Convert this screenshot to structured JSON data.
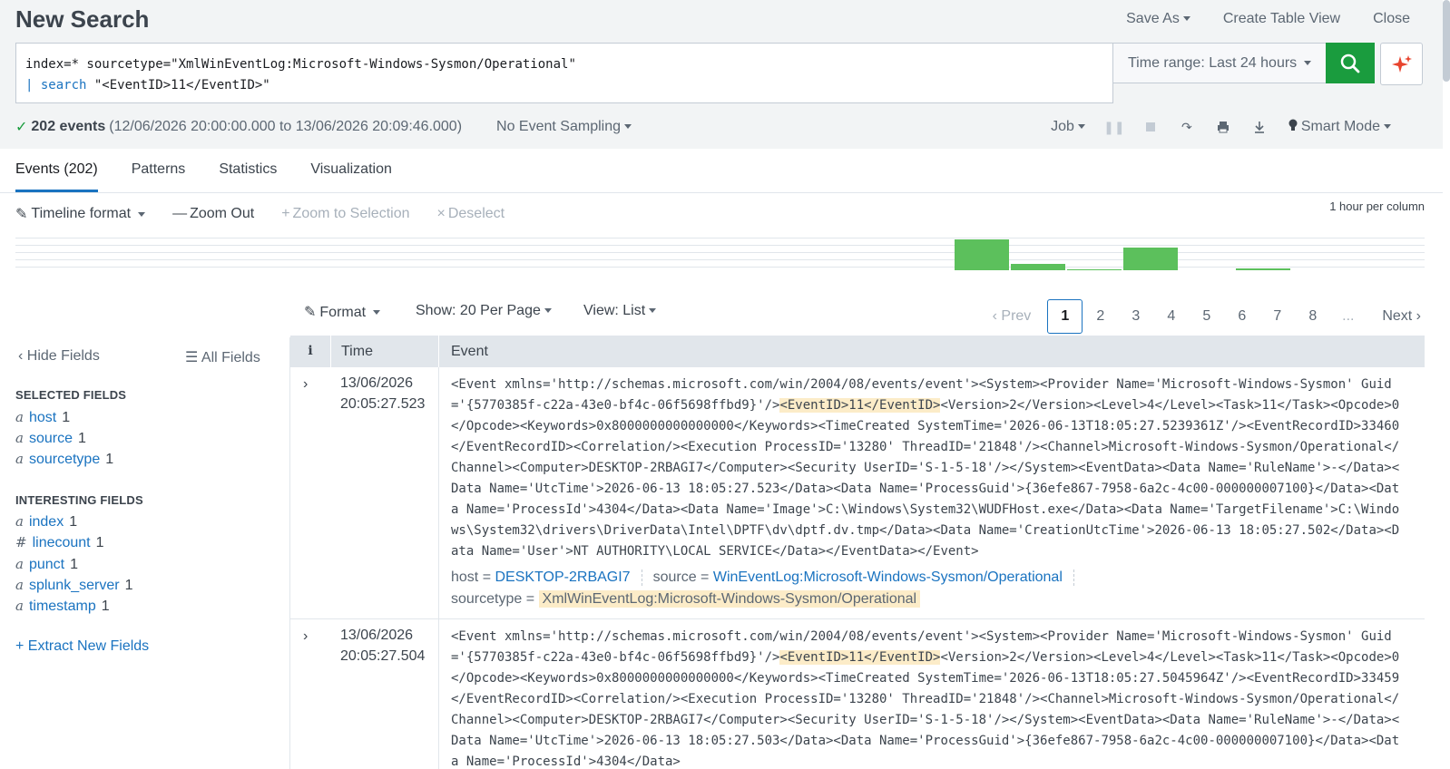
{
  "header": {
    "title": "New Search",
    "save_as": "Save As",
    "create_table_view": "Create Table View",
    "close": "Close"
  },
  "search": {
    "line1": "index=* sourcetype=\"XmlWinEventLog:Microsoft-Windows-Sysmon/Operational\"",
    "line2_pipe": "| ",
    "line2_cmd": "search",
    "line2_rest": " \"<EventID>11</EventID>\"",
    "time_range": "Time range: Last 24 hours"
  },
  "status": {
    "check": "✓",
    "count": "202 events",
    "range": "(12/06/2026 20:00:00.000 to 13/06/2026 20:09:46.000)",
    "sampling": "No Event Sampling",
    "job": "Job",
    "mode": "Smart Mode"
  },
  "tabs": [
    {
      "label": "Events (202)"
    },
    {
      "label": "Patterns"
    },
    {
      "label": "Statistics"
    },
    {
      "label": "Visualization"
    }
  ],
  "timeline": {
    "format": "Timeline format",
    "zoom_out": "Zoom Out",
    "zoom_selection": "Zoom to Selection",
    "deselect": "Deselect",
    "per_column": "1 hour per column",
    "bars": [
      0,
      0,
      0,
      0,
      0,
      0,
      0,
      0,
      0,
      0,
      0,
      0,
      0,
      0,
      0,
      0,
      0,
      0,
      0,
      0,
      0,
      0,
      0,
      0,
      0,
      0,
      0,
      0,
      0,
      0,
      0,
      0,
      0,
      0,
      0,
      0,
      0,
      0,
      0,
      0,
      0,
      0,
      0,
      0,
      0,
      0,
      0,
      0,
      0,
      0,
      0,
      0,
      0,
      0,
      0,
      0,
      0,
      0,
      0,
      0,
      0,
      0,
      0,
      0,
      0,
      0,
      0,
      0,
      0,
      0,
      0,
      0,
      0,
      0,
      0,
      0,
      0,
      0,
      0,
      0,
      0,
      0,
      0,
      0,
      0,
      0,
      0,
      0,
      0,
      0,
      0,
      0,
      0,
      0,
      0,
      0,
      0,
      0,
      0,
      0
    ]
  },
  "chart_data": {
    "type": "bar",
    "values": [
      95,
      20,
      3,
      70,
      0,
      5
    ]
  },
  "controls": {
    "format": "Format",
    "show": "Show: 20 Per Page",
    "view": "View: List",
    "prev": "Prev",
    "next": "Next",
    "pages": [
      "1",
      "2",
      "3",
      "4",
      "5",
      "6",
      "7",
      "8",
      "..."
    ]
  },
  "sidebar": {
    "hide_fields": "Hide Fields",
    "all_fields": "All Fields",
    "selected_title": "SELECTED FIELDS",
    "selected": [
      {
        "type": "a",
        "name": "host",
        "count": "1"
      },
      {
        "type": "a",
        "name": "source",
        "count": "1"
      },
      {
        "type": "a",
        "name": "sourcetype",
        "count": "1"
      }
    ],
    "interesting_title": "INTERESTING FIELDS",
    "interesting": [
      {
        "type": "a",
        "name": "index",
        "count": "1"
      },
      {
        "type": "#",
        "name": "linecount",
        "count": "1"
      },
      {
        "type": "a",
        "name": "punct",
        "count": "1"
      },
      {
        "type": "a",
        "name": "splunk_server",
        "count": "1"
      },
      {
        "type": "a",
        "name": "timestamp",
        "count": "1"
      }
    ],
    "extract": "Extract New Fields"
  },
  "table": {
    "col_info": "i",
    "col_time": "Time",
    "col_event": "Event"
  },
  "events": [
    {
      "date": "13/06/2026",
      "time": "20:05:27.523",
      "pre": "<Event xmlns='http://schemas.microsoft.com/win/2004/08/events/event'><System><Provider Name='Microsoft-Windows-Sysmon' Guid='{5770385f-c22a-43e0-bf4c-06f5698ffbd9}'/>",
      "hl": "<EventID>11</EventID>",
      "post": "<Version>2</Version><Level>4</Level><Task>11</Task><Opcode>0</Opcode><Keywords>0x8000000000000000</Keywords><TimeCreated SystemTime='2026-06-13T18:05:27.5239361Z'/><EventRecordID>33460</EventRecordID><Correlation/><Execution ProcessID='13280' ThreadID='21848'/><Channel>Microsoft-Windows-Sysmon/Operational</Channel><Computer>DESKTOP-2RBAGI7</Computer><Security UserID='S-1-5-18'/></System><EventData><Data Name='RuleName'>-</Data><Data Name='UtcTime'>2026-06-13 18:05:27.523</Data><Data Name='ProcessGuid'>{36efe867-7958-6a2c-4c00-000000007100}</Data><Data Name='ProcessId'>4304</Data><Data Name='Image'>C:\\Windows\\System32\\WUDFHost.exe</Data><Data Name='TargetFilename'>C:\\Windows\\System32\\drivers\\DriverData\\Intel\\DPTF\\dv\\dptf.dv.tmp</Data><Data Name='CreationUtcTime'>2026-06-13 18:05:27.502</Data><Data Name='User'>NT AUTHORITY\\LOCAL SERVICE</Data></EventData></Event>",
      "host_label": "host =",
      "host": "DESKTOP-2RBAGI7",
      "source_label": "source =",
      "source": "WinEventLog:Microsoft-Windows-Sysmon/Operational",
      "sourcetype_label": "sourcetype =",
      "sourcetype": "XmlWinEventLog:Microsoft-Windows-Sysmon/Operational"
    },
    {
      "date": "13/06/2026",
      "time": "20:05:27.504",
      "pre": "<Event xmlns='http://schemas.microsoft.com/win/2004/08/events/event'><System><Provider Name='Microsoft-Windows-Sysmon' Guid='{5770385f-c22a-43e0-bf4c-06f5698ffbd9}'/>",
      "hl": "<EventID>11</EventID>",
      "post": "<Version>2</Version><Level>4</Level><Task>11</Task><Opcode>0</Opcode><Keywords>0x8000000000000000</Keywords><TimeCreated SystemTime='2026-06-13T18:05:27.5045964Z'/><EventRecordID>33459</EventRecordID><Correlation/><Execution ProcessID='13280' ThreadID='21848'/><Channel>Microsoft-Windows-Sysmon/Operational</Channel><Computer>DESKTOP-2RBAGI7</Computer><Security UserID='S-1-5-18'/></System><EventData><Data Name='RuleName'>-</Data><Data Name='UtcTime'>2026-06-13 18:05:27.503</Data><Data Name='ProcessGuid'>{36efe867-7958-6a2c-4c00-000000007100}</Data><Data Name='ProcessId'>4304</Data>"
    }
  ]
}
